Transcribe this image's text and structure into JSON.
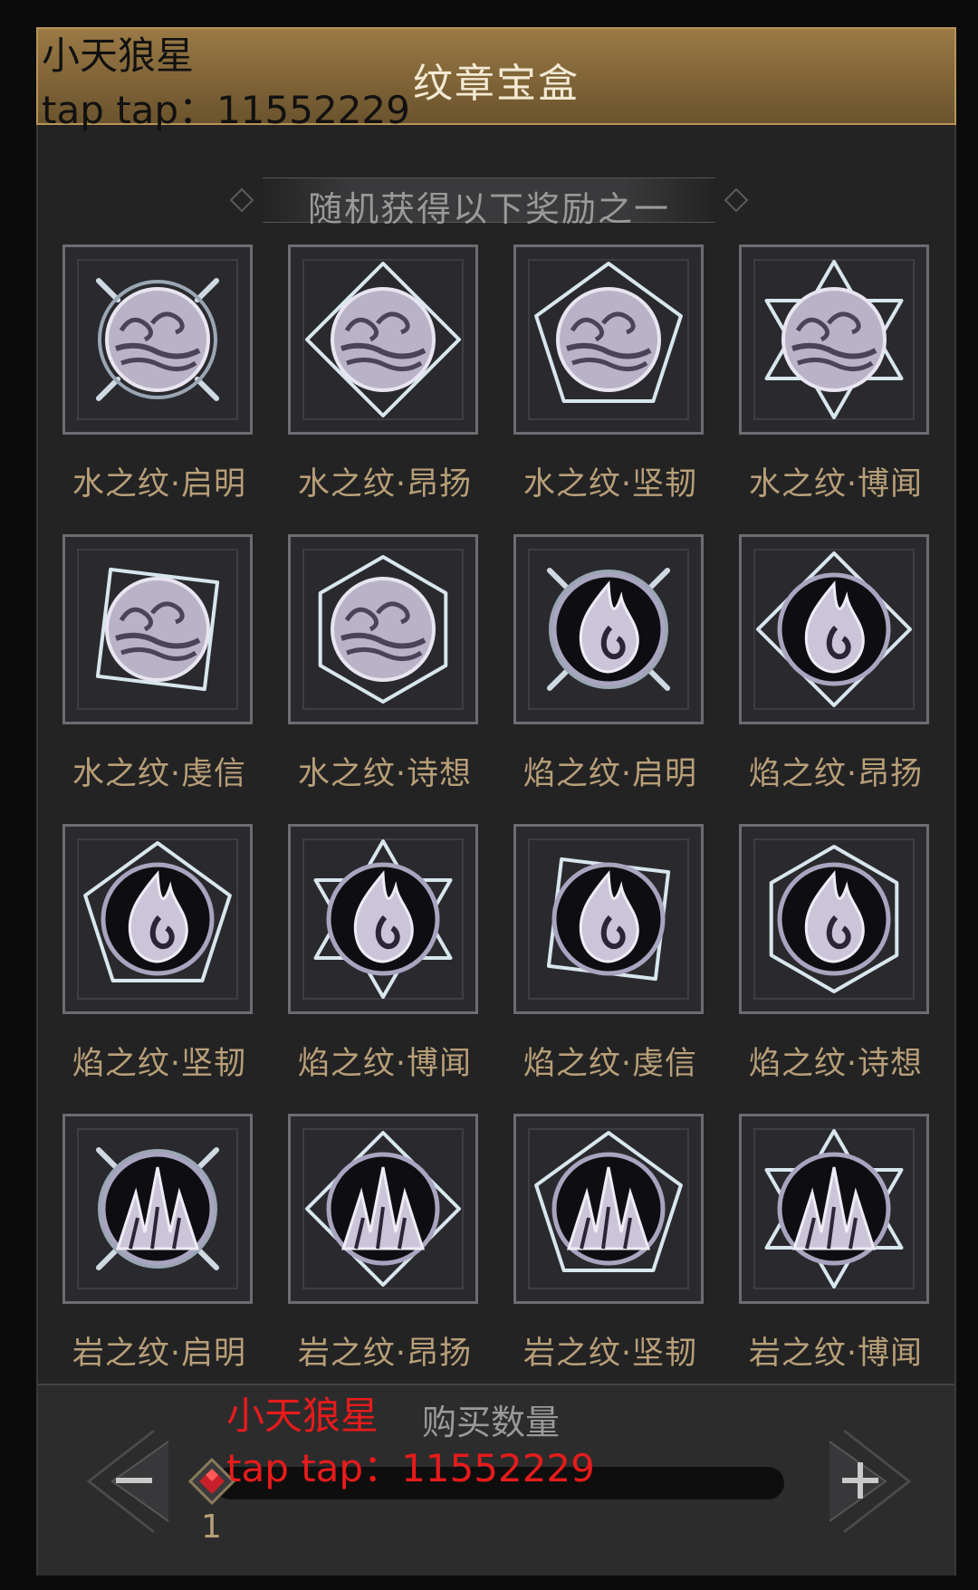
{
  "header": {
    "title": "纹章宝盒"
  },
  "watermark": {
    "name": "小天狼星",
    "id": "tap tap：11552229"
  },
  "subtitle": "随机获得以下奖励之一",
  "rewards": [
    {
      "label": "水之纹·启明",
      "element": "water",
      "shape": "spikes"
    },
    {
      "label": "水之纹·昂扬",
      "element": "water",
      "shape": "diamond"
    },
    {
      "label": "水之纹·坚韧",
      "element": "water",
      "shape": "pentagon"
    },
    {
      "label": "水之纹·博闻",
      "element": "water",
      "shape": "hexagram"
    },
    {
      "label": "水之纹·虔信",
      "element": "water",
      "shape": "square"
    },
    {
      "label": "水之纹·诗想",
      "element": "water",
      "shape": "hexagon"
    },
    {
      "label": "焰之纹·启明",
      "element": "fire",
      "shape": "spikes"
    },
    {
      "label": "焰之纹·昂扬",
      "element": "fire",
      "shape": "diamond"
    },
    {
      "label": "焰之纹·坚韧",
      "element": "fire",
      "shape": "pentagon"
    },
    {
      "label": "焰之纹·博闻",
      "element": "fire",
      "shape": "hexagram"
    },
    {
      "label": "焰之纹·虔信",
      "element": "fire",
      "shape": "square"
    },
    {
      "label": "焰之纹·诗想",
      "element": "fire",
      "shape": "hexagon"
    },
    {
      "label": "岩之纹·启明",
      "element": "rock",
      "shape": "spikes"
    },
    {
      "label": "岩之纹·昂扬",
      "element": "rock",
      "shape": "diamond"
    },
    {
      "label": "岩之纹·坚韧",
      "element": "rock",
      "shape": "pentagon"
    },
    {
      "label": "岩之纹·博闻",
      "element": "rock",
      "shape": "hexagram"
    }
  ],
  "purchase": {
    "label": "购买数量",
    "quantity": "1",
    "minus_icon": "minus-icon",
    "plus_icon": "plus-icon"
  },
  "colors": {
    "gold": "#b89f78",
    "title_bar": "#7d6236",
    "watermark_red": "#e81b1b"
  }
}
